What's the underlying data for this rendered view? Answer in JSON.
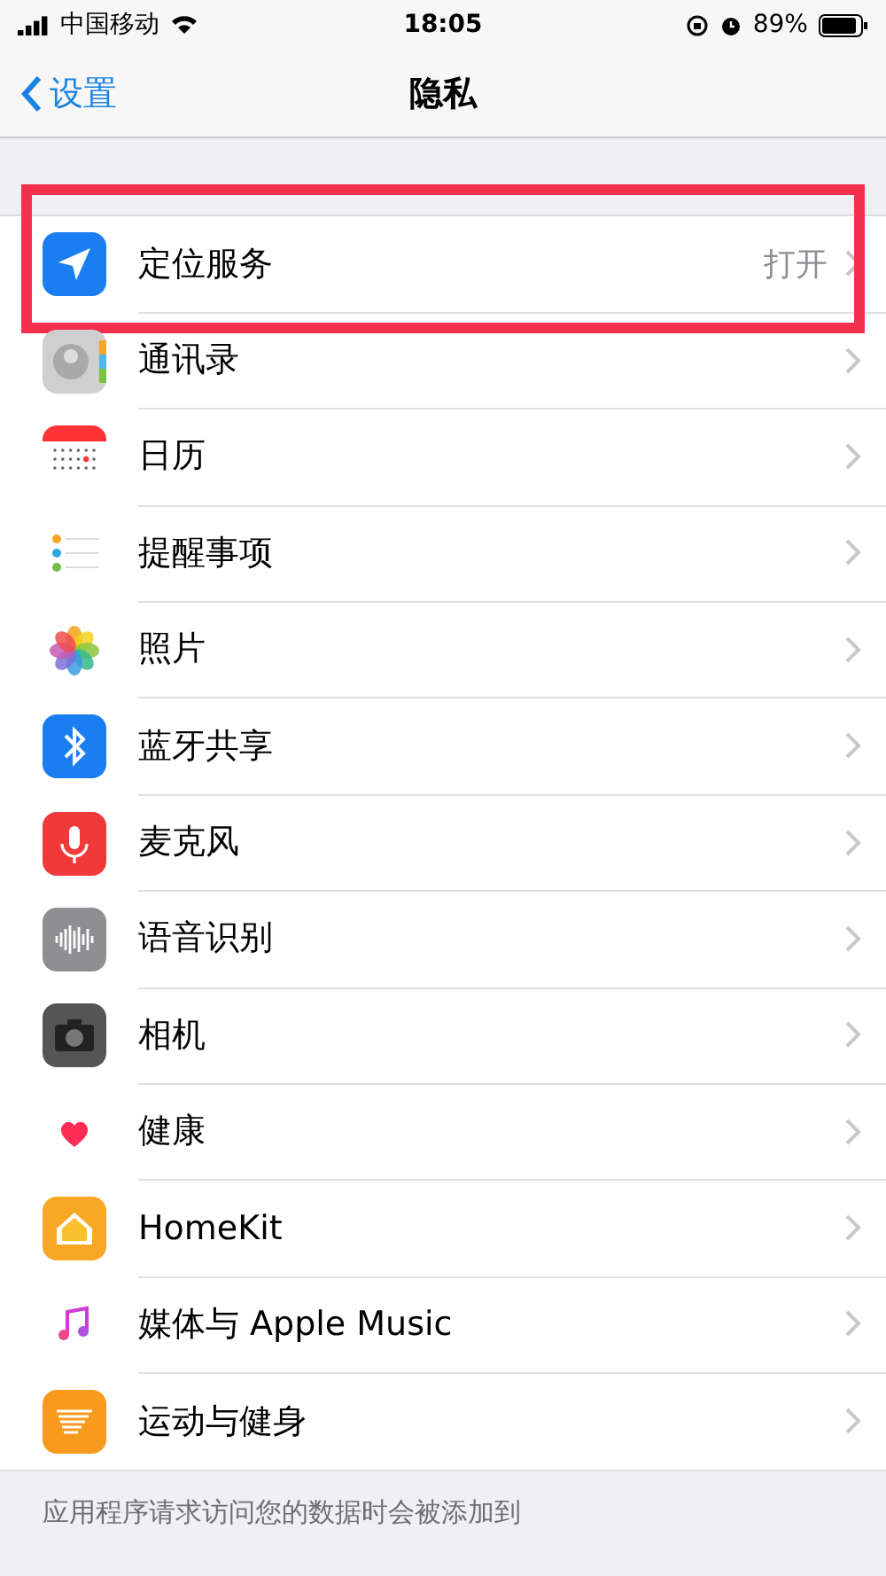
{
  "status_bar": {
    "carrier": "中国移动",
    "time": "18:05",
    "battery": "89%"
  },
  "nav": {
    "back": "设置",
    "title": "隐私"
  },
  "items": [
    {
      "kind": "location",
      "label": "定位服务",
      "value": "打开",
      "highlighted": true
    },
    {
      "kind": "contacts",
      "label": "通讯录",
      "highlighted": false
    },
    {
      "kind": "calendar",
      "label": "日历",
      "highlighted": false
    },
    {
      "kind": "reminders",
      "label": "提醒事项",
      "highlighted": false
    },
    {
      "kind": "photos",
      "label": "照片",
      "highlighted": false
    },
    {
      "kind": "bluetooth",
      "label": "蓝牙共享",
      "highlighted": false
    },
    {
      "kind": "microphone",
      "label": "麦克风",
      "highlighted": false
    },
    {
      "kind": "speech",
      "label": "语音识别",
      "highlighted": false
    },
    {
      "kind": "camera",
      "label": "相机",
      "highlighted": false
    },
    {
      "kind": "health",
      "label": "健康",
      "highlighted": false
    },
    {
      "kind": "home",
      "label": "HomeKit",
      "highlighted": false
    },
    {
      "kind": "music",
      "label": "媒体与 Apple Music",
      "highlighted": false
    },
    {
      "kind": "motion",
      "label": "运动与健身",
      "highlighted": false
    }
  ],
  "footer": "应用程序请求访问您的数据时会被添加到"
}
